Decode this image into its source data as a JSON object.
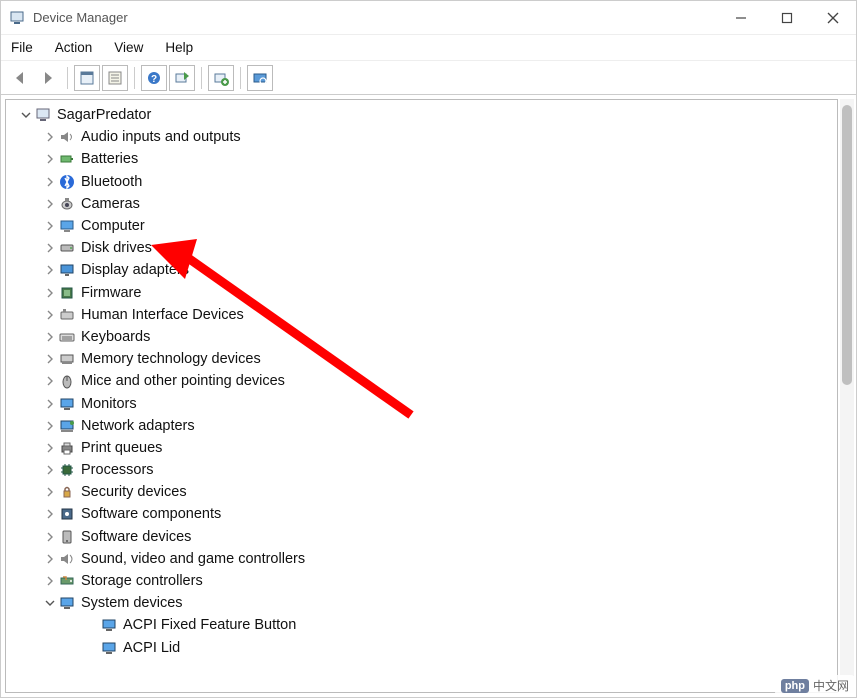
{
  "window": {
    "title": "Device Manager"
  },
  "menubar": [
    "File",
    "Action",
    "View",
    "Help"
  ],
  "toolbar": [
    {
      "name": "back-icon"
    },
    {
      "name": "forward-icon"
    },
    {
      "name": "show-hidden-icon",
      "boxed": true
    },
    {
      "name": "properties-icon",
      "boxed": true
    },
    {
      "name": "help-icon",
      "boxed": true
    },
    {
      "name": "update-driver-icon",
      "boxed": true
    },
    {
      "name": "uninstall-icon",
      "boxed": true
    },
    {
      "name": "scan-hardware-icon",
      "boxed": true
    }
  ],
  "tree": {
    "root": {
      "label": "SagarPredator",
      "expanded": true,
      "icon": "computer"
    },
    "categories": [
      {
        "label": "Audio inputs and outputs",
        "icon": "speaker"
      },
      {
        "label": "Batteries",
        "icon": "battery"
      },
      {
        "label": "Bluetooth",
        "icon": "bluetooth"
      },
      {
        "label": "Cameras",
        "icon": "camera"
      },
      {
        "label": "Computer",
        "icon": "pc"
      },
      {
        "label": "Disk drives",
        "icon": "disk",
        "highlighted": true
      },
      {
        "label": "Display adapters",
        "icon": "display"
      },
      {
        "label": "Firmware",
        "icon": "firmware"
      },
      {
        "label": "Human Interface Devices",
        "icon": "hid"
      },
      {
        "label": "Keyboards",
        "icon": "keyboard"
      },
      {
        "label": "Memory technology devices",
        "icon": "memory"
      },
      {
        "label": "Mice and other pointing devices",
        "icon": "mouse"
      },
      {
        "label": "Monitors",
        "icon": "monitor"
      },
      {
        "label": "Network adapters",
        "icon": "network"
      },
      {
        "label": "Print queues",
        "icon": "printer"
      },
      {
        "label": "Processors",
        "icon": "cpu"
      },
      {
        "label": "Security devices",
        "icon": "security"
      },
      {
        "label": "Software components",
        "icon": "softcomp"
      },
      {
        "label": "Software devices",
        "icon": "softdev"
      },
      {
        "label": "Sound, video and game controllers",
        "icon": "sound"
      },
      {
        "label": "Storage controllers",
        "icon": "storage"
      },
      {
        "label": "System devices",
        "icon": "system",
        "expanded": true,
        "children": [
          {
            "label": "ACPI Fixed Feature Button",
            "icon": "sysdev"
          },
          {
            "label": "ACPI Lid",
            "icon": "sysdev"
          }
        ]
      }
    ]
  },
  "watermark": {
    "brand": "php",
    "text": "中文网"
  },
  "annotation": {
    "color": "#ff0000",
    "target": "Disk drives"
  }
}
